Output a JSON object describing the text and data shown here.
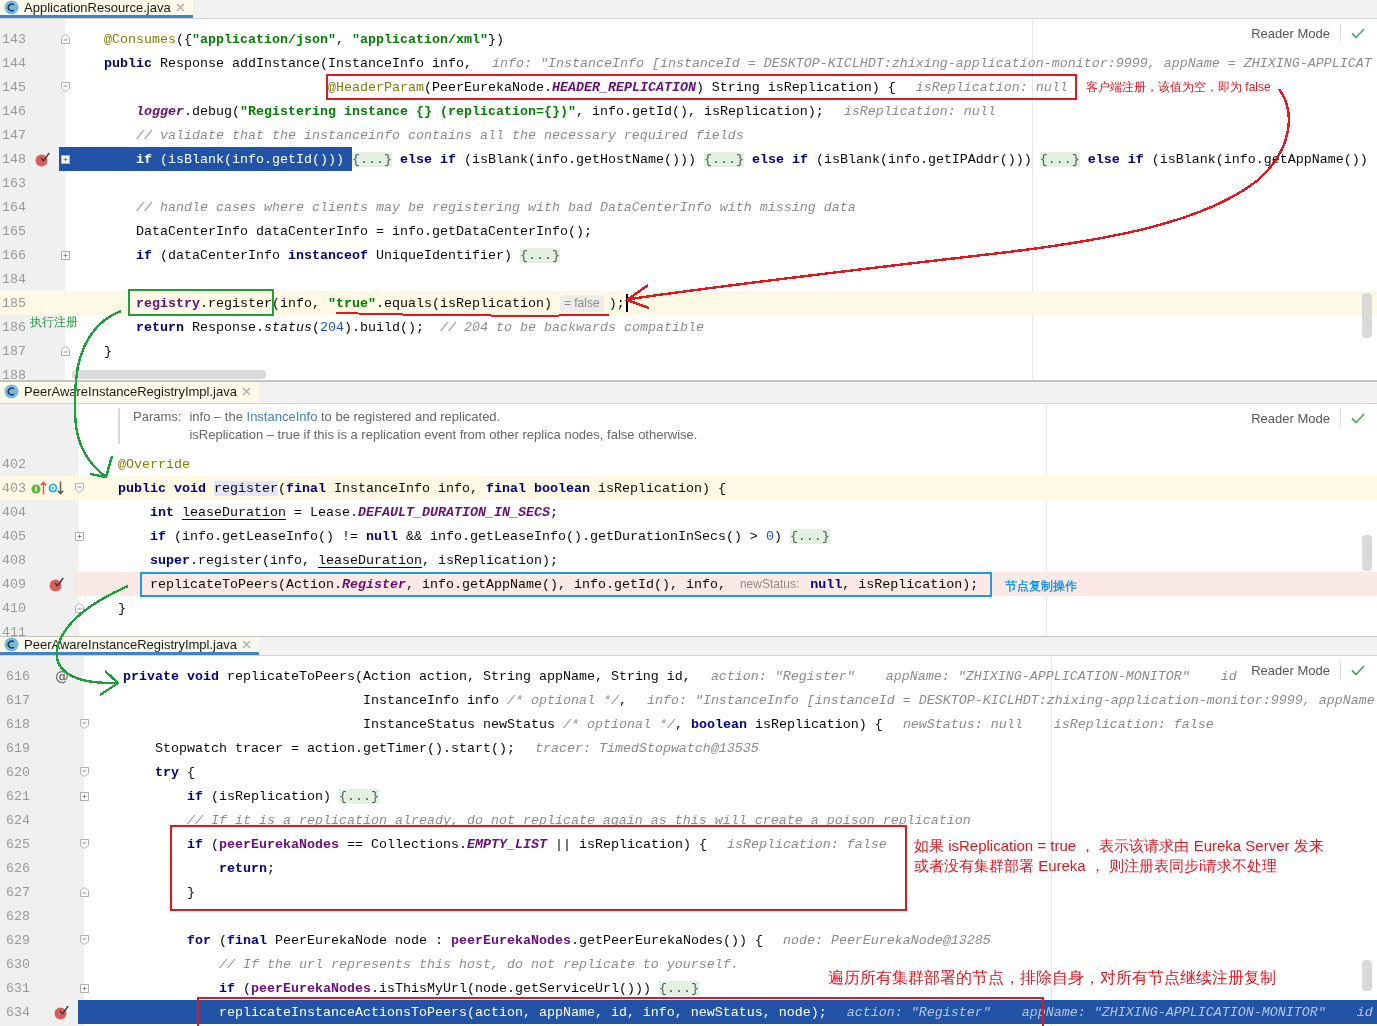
{
  "panes": [
    {
      "tab": {
        "label": "ApplicationResource.java",
        "selected": true
      },
      "reader_mode": "Reader Mode",
      "lines": [
        {
          "number": "143",
          "kind": "plain",
          "gutter": [
            {
              "kind": "fold_end"
            }
          ],
          "tokens": [
            {
              "kind": "ann",
              "text": "@Consumes"
            },
            {
              "kind": "plain",
              "text": "({"
            },
            {
              "kind": "str",
              "text": "\"application/json\""
            },
            {
              "kind": "plain",
              "text": ", "
            },
            {
              "kind": "str",
              "text": "\"application/xml\""
            },
            {
              "kind": "plain",
              "text": "})"
            }
          ]
        },
        {
          "number": "144",
          "kind": "plain",
          "head": [
            {
              "kind": "kw",
              "text": "public"
            },
            {
              "kind": "plain",
              "text": " Response addInstance("
            }
          ],
          "tokens": [
            {
              "kind": "plain",
              "text": "InstanceInfo info,"
            },
            {
              "kind": "hint",
              "text": "info: \"InstanceInfo [instanceId = DESKTOP-KICLHDT:zhixing-application-monitor:9999, appName = ZHIXING-APPLICAT"
            }
          ],
          "continuation": [
            {
              "number": "145",
              "kind": "plain",
              "gutter": [
                {
                  "kind": "fold_start"
                }
              ],
              "tokens": [
                {
                  "kind": "ann",
                  "text": "@HeaderParam"
                },
                {
                  "kind": "plain",
                  "text": "(PeerEurekaNode."
                },
                {
                  "kind": "static",
                  "text": "HEADER_REPLICATION"
                },
                {
                  "kind": "plain",
                  "text": ") String isReplication) {"
                },
                {
                  "kind": "hint",
                  "text": "isReplication: null"
                }
              ]
            }
          ],
          "children": [
            {
              "number": "146",
              "kind": "plain",
              "tokens": [
                {
                  "kind": "static",
                  "text": "logger"
                },
                {
                  "kind": "plain",
                  "text": ".debug("
                },
                {
                  "kind": "str",
                  "text": "\"Registering instance {} (replication={})\""
                },
                {
                  "kind": "plain",
                  "text": ", info.getId(), isReplication);"
                },
                {
                  "kind": "hint",
                  "text": "isReplication: null"
                }
              ]
            },
            {
              "number": "147",
              "kind": "plain",
              "tokens": [
                {
                  "kind": "cmt",
                  "text": "// validate that the instanceinfo contains all the necessary required fields"
                }
              ]
            },
            {
              "number": "148",
              "kind": "execution",
              "gutter": [
                {
                  "kind": "breakpoint"
                },
                {
                  "kind": "fold_collapsed"
                }
              ],
              "tokens": [
                {
                  "kind": "kw",
                  "text": "if"
                },
                {
                  "kind": "plain",
                  "text": " (isBlank(info.getId()))"
                },
                {
                  "kind": "fold",
                  "text": "{...}"
                },
                {
                  "kind": "kw",
                  "text": "else if"
                },
                {
                  "kind": "plain",
                  "text": " (isBlank(info.getHostName()))"
                },
                {
                  "kind": "fold",
                  "text": "{...}"
                },
                {
                  "kind": "kw",
                  "text": "else if"
                },
                {
                  "kind": "plain",
                  "text": " (isBlank(info.getIPAddr()))"
                },
                {
                  "kind": "fold",
                  "text": "{...}"
                },
                {
                  "kind": "kw",
                  "text": "else if"
                },
                {
                  "kind": "plain",
                  "text": " (isBlank(info.getAppName())"
                }
              ]
            },
            {
              "number": "163",
              "kind": "plain"
            },
            {
              "number": "164",
              "kind": "plain",
              "tokens": [
                {
                  "kind": "cmt",
                  "text": "// handle cases where clients may be registering with bad DataCenterInfo with missing data"
                }
              ]
            },
            {
              "number": "165",
              "kind": "plain",
              "tokens": [
                {
                  "kind": "plain",
                  "text": "DataCenterInfo dataCenterInfo = info.getDataCenterInfo();"
                }
              ]
            },
            {
              "number": "166",
              "kind": "plain",
              "gutter": [
                {
                  "kind": "fold_collapsed"
                }
              ],
              "tokens": [
                {
                  "kind": "kw",
                  "text": "if"
                },
                {
                  "kind": "plain",
                  "text": " (dataCenterInfo "
                },
                {
                  "kind": "kw",
                  "text": "instanceof"
                },
                {
                  "kind": "plain",
                  "text": " UniqueIdentifier)"
                },
                {
                  "kind": "fold",
                  "text": "{...}"
                }
              ]
            },
            {
              "number": "184",
              "kind": "plain"
            },
            {
              "number": "185",
              "kind": "caret",
              "tokens": [
                {
                  "kind": "field",
                  "text": "registry"
                },
                {
                  "kind": "plain",
                  "text": ".register(info, "
                },
                {
                  "kind": "str",
                  "text": "\"true\""
                },
                {
                  "kind": "plain",
                  "text": ".equals(isReplication)"
                },
                {
                  "kind": "value",
                  "text": "= false"
                },
                {
                  "kind": "plain",
                  "text": ");"
                },
                {
                  "kind": "cursor"
                }
              ]
            },
            {
              "number": "186",
              "kind": "plain",
              "tokens": [
                {
                  "kind": "kw",
                  "text": "return"
                },
                {
                  "kind": "plain",
                  "text": " Response."
                },
                {
                  "kind": "italic",
                  "text": "status"
                },
                {
                  "kind": "plain",
                  "text": "("
                },
                {
                  "kind": "num",
                  "text": "204"
                },
                {
                  "kind": "plain",
                  "text": ").build();  "
                },
                {
                  "kind": "cmt",
                  "text": "// 204 to be backwards compatible"
                }
              ]
            }
          ]
        },
        {
          "number": "187",
          "kind": "plain",
          "gutter": [
            {
              "kind": "fold_end"
            }
          ],
          "tokens": [
            {
              "kind": "plain",
              "text": "}"
            }
          ]
        },
        {
          "number": "188",
          "kind": "plain"
        }
      ]
    },
    {
      "tab": {
        "label": "PeerAwareInstanceRegistryImpl.java",
        "selected": false
      },
      "reader_mode": "Reader Mode",
      "doc": {
        "label": "Params:",
        "params": [
          [
            {
              "kind": "text",
              "text": "info – the"
            },
            {
              "kind": "link",
              "text": "InstanceInfo"
            },
            {
              "kind": "text",
              "text": "to be registered and replicated."
            }
          ],
          [
            {
              "kind": "text",
              "text": "isReplication – true if this is a replication event from other replica nodes, false otherwise."
            }
          ]
        ]
      },
      "lines": [
        {
          "number": "402",
          "kind": "plain",
          "tokens": [
            {
              "kind": "ann",
              "text": "@Override"
            }
          ]
        },
        {
          "number": "403",
          "kind": "caret",
          "gutter": [
            {
              "kind": "implements"
            },
            {
              "kind": "overrides"
            },
            {
              "kind": "fold_start"
            }
          ],
          "tokens": [
            {
              "kind": "kw",
              "text": "public void "
            },
            {
              "kind": "usage",
              "text": "register"
            },
            {
              "kind": "plain",
              "text": "("
            },
            {
              "kind": "kw",
              "text": "final"
            },
            {
              "kind": "plain",
              "text": " InstanceInfo info, "
            },
            {
              "kind": "kw",
              "text": "final boolean"
            },
            {
              "kind": "plain",
              "text": " isReplication) {"
            }
          ],
          "children": [
            {
              "number": "404",
              "kind": "plain",
              "tokens": [
                {
                  "kind": "kw",
                  "text": "int "
                },
                {
                  "kind": "under",
                  "text": "leaseDuration"
                },
                {
                  "kind": "plain",
                  "text": " = Lease."
                },
                {
                  "kind": "static",
                  "text": "DEFAULT_DURATION_IN_SECS"
                },
                {
                  "kind": "plain",
                  "text": ";"
                }
              ]
            },
            {
              "number": "405",
              "kind": "plain",
              "gutter": [
                {
                  "kind": "fold_collapsed"
                }
              ],
              "tokens": [
                {
                  "kind": "kw",
                  "text": "if"
                },
                {
                  "kind": "plain",
                  "text": " (info.getLeaseInfo() != "
                },
                {
                  "kind": "kw",
                  "text": "null"
                },
                {
                  "kind": "plain",
                  "text": " && info.getLeaseInfo().getDurationInSecs() > "
                },
                {
                  "kind": "num",
                  "text": "0"
                },
                {
                  "kind": "plain",
                  "text": ")"
                },
                {
                  "kind": "fold",
                  "text": "{...}"
                }
              ]
            },
            {
              "number": "408",
              "kind": "plain",
              "tokens": [
                {
                  "kind": "kw",
                  "text": "super"
                },
                {
                  "kind": "plain",
                  "text": ".register(info, "
                },
                {
                  "kind": "under",
                  "text": "leaseDuration"
                },
                {
                  "kind": "plain",
                  "text": ", isReplication);"
                }
              ]
            },
            {
              "number": "409",
              "kind": "breakpoint",
              "gutter": [
                {
                  "kind": "breakpoint"
                }
              ],
              "tokens": [
                {
                  "kind": "plain",
                  "text": "replicateToPeers(Action."
                },
                {
                  "kind": "static",
                  "text": "Register"
                },
                {
                  "kind": "plain",
                  "text": ", info.getAppName(), info.getId(), info,"
                },
                {
                  "kind": "param",
                  "text": "newStatus:"
                },
                {
                  "kind": "kw",
                  "text": "null"
                },
                {
                  "kind": "plain",
                  "text": ", isReplication);"
                }
              ]
            }
          ]
        },
        {
          "number": "410",
          "kind": "plain",
          "gutter": [
            {
              "kind": "fold_end"
            }
          ],
          "tokens": [
            {
              "kind": "plain",
              "text": "}"
            }
          ]
        },
        {
          "number": "411",
          "kind": "plain"
        }
      ]
    },
    {
      "tab": {
        "label": "PeerAwareInstanceRegistryImpl.java",
        "selected": true
      },
      "reader_mode": "Reader Mode",
      "lines": [
        {
          "number": "616",
          "kind": "plain",
          "gutter": [
            {
              "kind": "text",
              "text": "@"
            }
          ],
          "head": [
            {
              "kind": "kw",
              "text": "private void"
            },
            {
              "kind": "plain",
              "text": " replicateToPeers("
            }
          ],
          "tokens": [
            {
              "kind": "plain",
              "text": "Action action, String appName, String id,"
            },
            {
              "kind": "hint",
              "text": "action: \"Register\""
            },
            {
              "kind": "hint",
              "text": "appName: \"ZHIXING-APPLICATION-MONITOR\""
            },
            {
              "kind": "hint",
              "text": "id"
            }
          ],
          "continuation": [
            {
              "number": "617",
              "kind": "plain",
              "tokens": [
                {
                  "kind": "plain",
                  "text": "InstanceInfo info "
                },
                {
                  "kind": "cmt",
                  "text": "/* optional */"
                },
                {
                  "kind": "plain",
                  "text": ","
                },
                {
                  "kind": "hint",
                  "text": "info: \"InstanceInfo [instanceId = DESKTOP-KICLHDT:zhixing-application-monitor:9999, appName"
                }
              ]
            },
            {
              "number": "618",
              "kind": "plain",
              "gutter": [
                {
                  "kind": "fold_start"
                }
              ],
              "tokens": [
                {
                  "kind": "plain",
                  "text": "InstanceStatus newStatus "
                },
                {
                  "kind": "cmt",
                  "text": "/* optional */"
                },
                {
                  "kind": "plain",
                  "text": ", "
                },
                {
                  "kind": "kw",
                  "text": "boolean"
                },
                {
                  "kind": "plain",
                  "text": " isReplication) {"
                },
                {
                  "kind": "hint",
                  "text": "newStatus: null"
                },
                {
                  "kind": "hint",
                  "text": "isReplication: false"
                }
              ]
            }
          ],
          "children": [
            {
              "number": "619",
              "kind": "plain",
              "tokens": [
                {
                  "kind": "plain",
                  "text": "Stopwatch tracer = action.getTimer().start();"
                },
                {
                  "kind": "hint",
                  "text": "tracer: TimedStopwatch@13535"
                }
              ]
            },
            {
              "number": "620",
              "kind": "plain",
              "gutter": [
                {
                  "kind": "fold_start"
                }
              ],
              "tokens": [
                {
                  "kind": "kw",
                  "text": "try"
                },
                {
                  "kind": "plain",
                  "text": " {"
                }
              ],
              "children": [
                {
                  "number": "621",
                  "kind": "plain",
                  "gutter": [
                    {
                      "kind": "fold_collapsed"
                    }
                  ],
                  "tokens": [
                    {
                      "kind": "kw",
                      "text": "if"
                    },
                    {
                      "kind": "plain",
                      "text": " (isReplication)"
                    },
                    {
                      "kind": "fold",
                      "text": "{...}"
                    }
                  ]
                },
                {
                  "number": "624",
                  "kind": "plain",
                  "tokens": [
                    {
                      "kind": "cmt",
                      "text": "// If it is a replication already, do not replicate again as this will create a poison replication"
                    }
                  ]
                },
                {
                  "number": "625",
                  "kind": "plain",
                  "gutter": [
                    {
                      "kind": "fold_start"
                    }
                  ],
                  "tokens": [
                    {
                      "kind": "kw",
                      "text": "if"
                    },
                    {
                      "kind": "plain",
                      "text": " ("
                    },
                    {
                      "kind": "field",
                      "text": "peerEurekaNodes"
                    },
                    {
                      "kind": "plain",
                      "text": " == Collections."
                    },
                    {
                      "kind": "static",
                      "text": "EMPTY_LIST"
                    },
                    {
                      "kind": "plain",
                      "text": " || isReplication) {"
                    },
                    {
                      "kind": "hint",
                      "text": "isReplication: false"
                    }
                  ],
                  "children": [
                    {
                      "number": "626",
                      "kind": "plain",
                      "tokens": [
                        {
                          "kind": "kw",
                          "text": "return"
                        },
                        {
                          "kind": "plain",
                          "text": ";"
                        }
                      ]
                    }
                  ]
                },
                {
                  "number": "627",
                  "kind": "plain",
                  "gutter": [
                    {
                      "kind": "fold_end"
                    }
                  ],
                  "tokens": [
                    {
                      "kind": "plain",
                      "text": "}"
                    }
                  ]
                },
                {
                  "number": "628",
                  "kind": "plain"
                },
                {
                  "number": "629",
                  "kind": "plain",
                  "gutter": [
                    {
                      "kind": "fold_start"
                    }
                  ],
                  "tokens": [
                    {
                      "kind": "kw",
                      "text": "for"
                    },
                    {
                      "kind": "plain",
                      "text": " ("
                    },
                    {
                      "kind": "kw",
                      "text": "final"
                    },
                    {
                      "kind": "plain",
                      "text": " PeerEurekaNode node : "
                    },
                    {
                      "kind": "field",
                      "text": "peerEurekaNodes"
                    },
                    {
                      "kind": "plain",
                      "text": ".getPeerEurekaNodes()) {"
                    },
                    {
                      "kind": "hint",
                      "text": "node: PeerEurekaNode@13285"
                    }
                  ],
                  "children": [
                    {
                      "number": "630",
                      "kind": "plain",
                      "tokens": [
                        {
                          "kind": "cmt",
                          "text": "// If the url represents this host, do not replicate to yourself."
                        }
                      ]
                    },
                    {
                      "number": "631",
                      "kind": "plain",
                      "gutter": [
                        {
                          "kind": "fold_collapsed"
                        }
                      ],
                      "tokens": [
                        {
                          "kind": "kw",
                          "text": "if"
                        },
                        {
                          "kind": "plain",
                          "text": " ("
                        },
                        {
                          "kind": "field",
                          "text": "peerEurekaNodes"
                        },
                        {
                          "kind": "plain",
                          "text": ".isThisMyUrl(node.getServiceUrl()))"
                        },
                        {
                          "kind": "fold",
                          "text": "{...}"
                        }
                      ]
                    },
                    {
                      "number": "634",
                      "kind": "execution",
                      "gutter": [
                        {
                          "kind": "breakpoint"
                        }
                      ],
                      "tokens": [
                        {
                          "kind": "plain",
                          "text": "replicateInstanceActionsToPeers(action, appName, id, info, newStatus, node);"
                        },
                        {
                          "kind": "hint",
                          "text": "action: \"Register\""
                        },
                        {
                          "kind": "hint",
                          "text": "appName: \"ZHIXING-APPLICATION-MONITOR\""
                        },
                        {
                          "kind": "hint",
                          "text": "id"
                        }
                      ]
                    }
                  ]
                }
              ]
            }
          ]
        }
      ]
    }
  ],
  "annotations": [
    {
      "kind": "box",
      "color": "#e8141e"
    },
    {
      "kind": "note",
      "color": "#e8141e",
      "lines": [
        "客户端注册，该值为空，即为 false"
      ]
    },
    {
      "kind": "arrow",
      "color": "#e8141e"
    },
    {
      "kind": "underline",
      "color": "#e8141e"
    },
    {
      "kind": "box",
      "color": "#1e9e3c"
    },
    {
      "kind": "note",
      "color": "#1e9e3c",
      "lines": [
        "执行注册"
      ]
    },
    {
      "kind": "arrow",
      "color": "#1e9e3c"
    },
    {
      "kind": "box",
      "color": "#1a9be6"
    },
    {
      "kind": "note",
      "color": "#1a9be6",
      "lines": [
        "节点复制操作"
      ]
    },
    {
      "kind": "arrow",
      "color": "#1e9e3c"
    },
    {
      "kind": "box",
      "color": "#e8141e"
    },
    {
      "kind": "note",
      "color": "#e8141e",
      "lines": [
        "如果 isReplication = true ， 表示该请求由 Eureka Server 发来",
        "或者没有集群部署 Eureka ， 则注册表同步i请求不处理"
      ]
    },
    {
      "kind": "note",
      "color": "#e8141e",
      "lines": [
        "遍历所有集群部署的节点，排除自身，对所有节点继续注册复制"
      ]
    },
    {
      "kind": "box",
      "color": "#e8141e"
    }
  ]
}
